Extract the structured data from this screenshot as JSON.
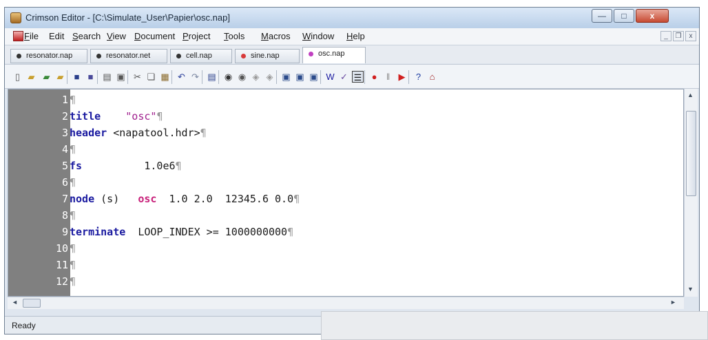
{
  "window": {
    "title": "Crimson Editor - [C:\\Simulate_User\\Papier\\osc.nap]",
    "min_glyph": "—",
    "max_glyph": "□",
    "close_glyph": "x"
  },
  "menubar": {
    "items": [
      {
        "acc": "F",
        "rest": "ile"
      },
      {
        "acc": "",
        "rest": "Edit"
      },
      {
        "acc": "S",
        "rest": "earch"
      },
      {
        "acc": "V",
        "rest": "iew"
      },
      {
        "acc": "D",
        "rest": "ocument"
      },
      {
        "acc": "P",
        "rest": "roject"
      },
      {
        "acc": "T",
        "rest": "ools"
      },
      {
        "acc": "M",
        "rest": "acros"
      },
      {
        "acc": "W",
        "rest": "indow"
      },
      {
        "acc": "H",
        "rest": "elp"
      }
    ],
    "mdi_min": "_",
    "mdi_restore": "❐",
    "mdi_close": "x"
  },
  "tabs": [
    {
      "label": "resonator.nap",
      "dot": "#333333"
    },
    {
      "label": "resonator.net",
      "dot": "#333333"
    },
    {
      "label": "cell.nap",
      "dot": "#333333"
    },
    {
      "label": "sine.nap",
      "dot": "#d83a3a"
    },
    {
      "label": "osc.nap",
      "dot": "#c040c0",
      "active": true
    }
  ],
  "toolbar": {
    "icons": [
      "new-file-icon",
      "open-folder-icon",
      "open-remote-icon",
      "open-project-icon",
      "save-icon",
      "save-all-icon",
      "print-icon",
      "print-preview-icon",
      "cut-icon",
      "copy-icon",
      "paste-icon",
      "undo-icon",
      "redo-icon",
      "toggle-output-icon",
      "find-icon",
      "find-next-icon",
      "replace-icon",
      "replace-next-icon",
      "view-option1-icon",
      "view-option2-icon",
      "view-option3-icon",
      "word-wrap-icon",
      "spell-check-icon",
      "line-numbers-icon",
      "record-macro-icon",
      "pause-macro-icon",
      "play-macro-icon",
      "help-icon",
      "home-icon"
    ]
  },
  "editor": {
    "lines": [
      {
        "num": "1",
        "parts": []
      },
      {
        "num": "2",
        "parts": [
          {
            "t": "title",
            "c": "kw"
          },
          {
            "t": "    ",
            "c": ""
          },
          {
            "t": "\"osc\"",
            "c": "str"
          }
        ]
      },
      {
        "num": "3",
        "parts": [
          {
            "t": "header",
            "c": "kw"
          },
          {
            "t": " <napatool.hdr>",
            "c": ""
          }
        ]
      },
      {
        "num": "4",
        "parts": []
      },
      {
        "num": "5",
        "parts": [
          {
            "t": "fs",
            "c": "kw"
          },
          {
            "t": "          1.0e6",
            "c": ""
          }
        ]
      },
      {
        "num": "6",
        "parts": []
      },
      {
        "num": "7",
        "parts": [
          {
            "t": "node",
            "c": "kw"
          },
          {
            "t": " (s)   ",
            "c": ""
          },
          {
            "t": "osc",
            "c": "fn"
          },
          {
            "t": "  1.0 2.0  12345.6 0.0",
            "c": ""
          }
        ]
      },
      {
        "num": "8",
        "parts": []
      },
      {
        "num": "9",
        "parts": [
          {
            "t": "terminate",
            "c": "kw"
          },
          {
            "t": "  LOOP_INDEX >= 1000000000",
            "c": ""
          }
        ]
      },
      {
        "num": "10",
        "parts": []
      },
      {
        "num": "11",
        "parts": []
      },
      {
        "num": "12",
        "parts": []
      }
    ],
    "eol_mark": "¶"
  },
  "scroll": {
    "up": "▲",
    "down": "▼",
    "left": "◄",
    "right": "►"
  },
  "status": {
    "text": "Ready"
  }
}
